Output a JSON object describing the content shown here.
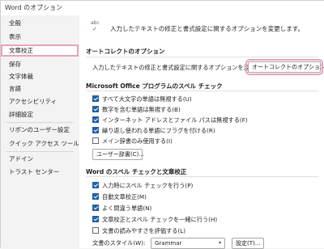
{
  "window": {
    "title": "Word のオプション"
  },
  "sidebar": {
    "items": [
      {
        "label": "全般"
      },
      {
        "label": "表示"
      },
      {
        "label": "文章校正"
      },
      {
        "label": "保存"
      },
      {
        "label": "文字体裁"
      },
      {
        "label": "言語"
      },
      {
        "label": "アクセシビリティ"
      },
      {
        "label": "詳細設定"
      },
      {
        "label": "リボンのユーザー設定"
      },
      {
        "label": "クイック アクセス ツール バー"
      },
      {
        "label": "アドイン"
      },
      {
        "label": "トラスト センター"
      }
    ],
    "selected": "文章校正"
  },
  "main": {
    "intro": "入力したテキストの修正と書式設定に関するオプションを変更します。",
    "autocorrect": {
      "heading": "オートコレクトのオプション",
      "desc": "入力したテキストの修正と書式設定に関するオプションを変更します。",
      "button": "オートコレクトのオプション(A)..."
    },
    "office_spell": {
      "heading": "Microsoft Office プログラムのスペル チェック",
      "options": [
        {
          "label": "すべて大文字の単語は無視する(U)",
          "checked": true
        },
        {
          "label": "数字を含む単語は無視する(B)",
          "checked": true
        },
        {
          "label": "インターネット アドレスとファイル パスは無視する(F)",
          "checked": true
        },
        {
          "label": "繰り返し使われる単語にフラグを付ける(R)",
          "checked": true
        },
        {
          "label": "メイン辞書のみ使用する(I)",
          "checked": false
        }
      ],
      "dict_button": "ユーザー辞書(C)..."
    },
    "word_spell": {
      "heading": "Word のスペル チェックと文章校正",
      "options": [
        {
          "label": "入力時にスペル チェックを行う(P)",
          "checked": true
        },
        {
          "label": "自動文章校正(M)",
          "checked": true
        },
        {
          "label": "よく間違う単語(N)",
          "checked": true
        },
        {
          "label": "文章校正とスペル チェックを一緒に行う(H)",
          "checked": true
        },
        {
          "label": "文書の読みやすさを評価する(L)",
          "checked": false
        }
      ],
      "style_label": "文書のスタイル(W):",
      "style_value": "Grammar",
      "settings_button": "設定(T)..."
    }
  }
}
